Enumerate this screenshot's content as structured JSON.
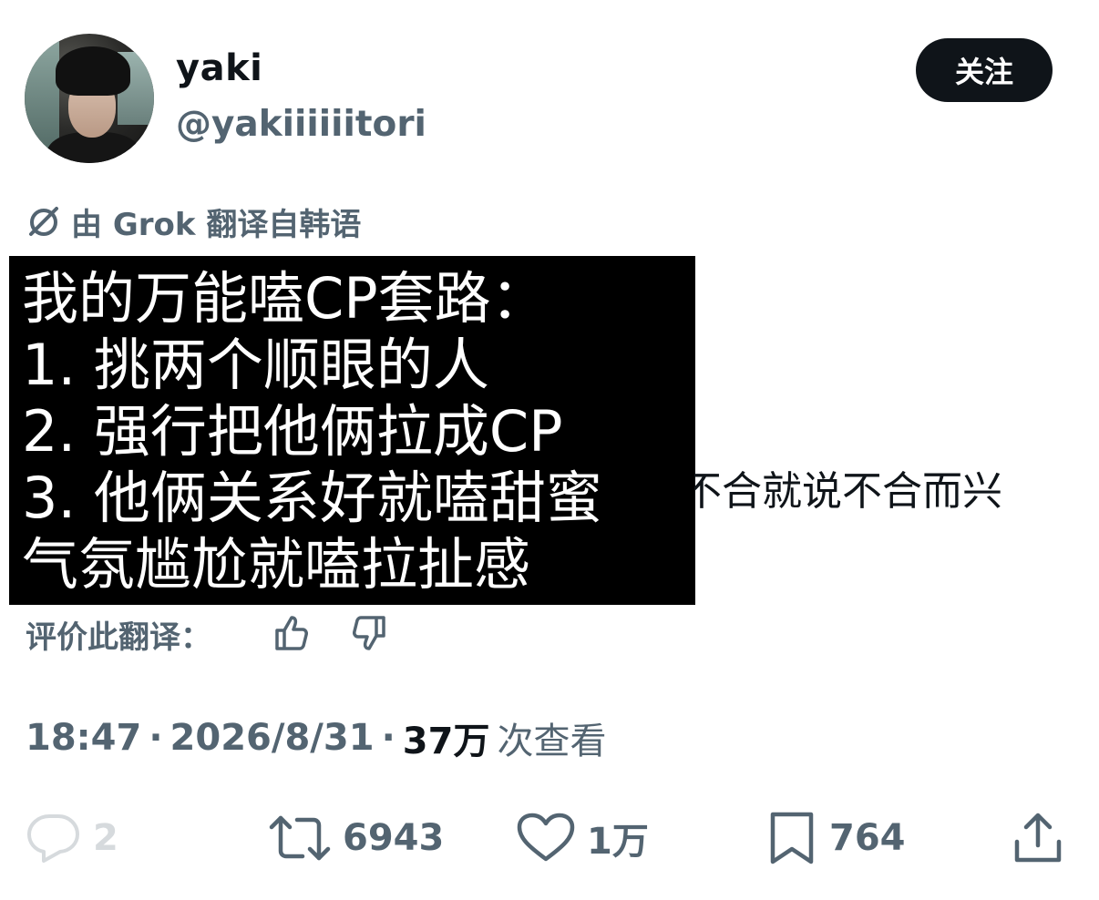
{
  "user": {
    "display_name": "yaki",
    "handle": "@yakiiiiiitori"
  },
  "follow_button": "关注",
  "translation": {
    "label": "由 Grok 翻译自韩语"
  },
  "text_image": {
    "lines": [
      "我的万能嗑CP套路：",
      "1. 挑两个顺眼的人",
      "2. 强行把他俩拉成CP",
      "3. 他俩关系好就嗑甜蜜",
      "气氛尴尬就嗑拉扯感"
    ],
    "overflow": "不合就说不合而兴"
  },
  "rate_translation": {
    "label": "评价此翻译："
  },
  "meta": {
    "time": "18:47",
    "separator": "·",
    "date": "2026/8/31",
    "views": "37万",
    "views_label": "次查看"
  },
  "actions": {
    "reply_count": "2",
    "retweet_count": "6943",
    "like_count": "1万",
    "bookmark_count": "764"
  },
  "colors": {
    "text_primary": "#0f1419",
    "text_secondary": "#536471",
    "button_bg": "#0f1419"
  }
}
